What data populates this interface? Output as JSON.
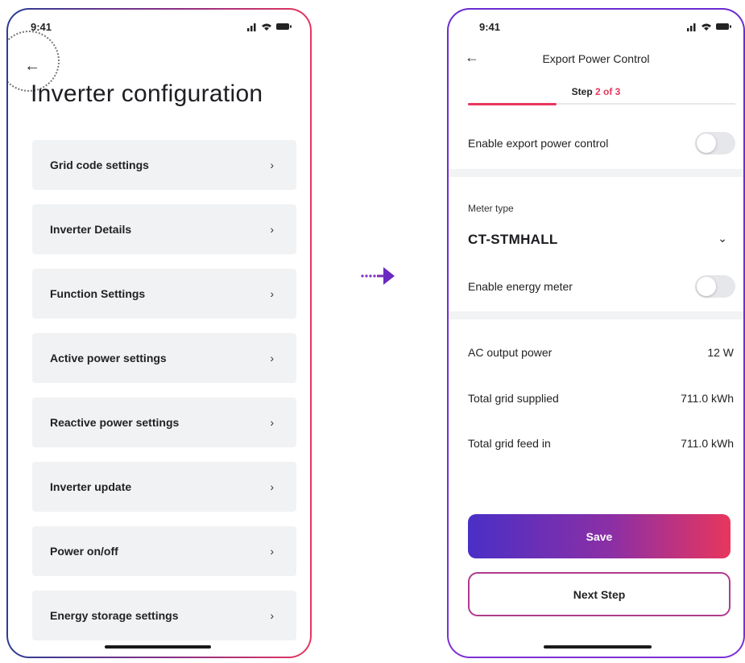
{
  "left_screen": {
    "status_time": "9:41",
    "status_icons": "signal-wifi-battery",
    "title": "Inverter configuration",
    "menu_items": [
      {
        "label": "Grid code settings"
      },
      {
        "label": "Inverter Details"
      },
      {
        "label": "Function Settings"
      },
      {
        "label": "Active power settings"
      },
      {
        "label": "Reactive power settings"
      },
      {
        "label": "Inverter update"
      },
      {
        "label": "Power on/off"
      },
      {
        "label": "Energy storage settings"
      }
    ],
    "chevron": "›"
  },
  "right_screen": {
    "status_time": "9:41",
    "nav_title": "Export Power Control",
    "step": {
      "prefix": "Step ",
      "current": "2",
      "separator": " of ",
      "total": "3",
      "progress": 0.33
    },
    "enable_export_label": "Enable export power control",
    "enable_export_on": false,
    "meter_type_label": "Meter type",
    "meter_type_value": "CT-STMHALL",
    "enable_energy_meter_label": "Enable energy meter",
    "enable_energy_meter_on": false,
    "readings": [
      {
        "label": "AC output power",
        "value": "12 W"
      },
      {
        "label": "Total grid supplied",
        "value": "711.0 kWh"
      },
      {
        "label": "Total grid feed in",
        "value": "711.0 kWh"
      }
    ],
    "save_label": "Save",
    "next_label": "Next Step"
  },
  "colors": {
    "accent": "#e8365d",
    "gradient_start": "#4a2fc6",
    "gradient_end": "#e8365d"
  }
}
